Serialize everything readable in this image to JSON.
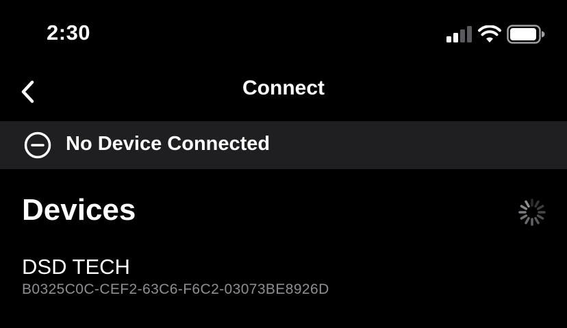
{
  "status_bar": {
    "time": "2:30",
    "icons": [
      "cellular-signal-icon",
      "wifi-icon",
      "battery-icon"
    ]
  },
  "nav": {
    "back_icon": "chevron-left-icon",
    "title": "Connect"
  },
  "connection_banner": {
    "icon": "minus-circle-icon",
    "text": "No Device Connected",
    "background": "#1f1f21"
  },
  "devices_section": {
    "title": "Devices",
    "loading_icon": "activity-spinner-icon",
    "items": [
      {
        "name": "DSD TECH",
        "identifier": "B0325C0C-CEF2-63C6-F6C2-03073BE8926D"
      }
    ]
  },
  "colors": {
    "background": "#000000",
    "text_primary": "#ffffff",
    "text_secondary": "#8e8e93"
  }
}
